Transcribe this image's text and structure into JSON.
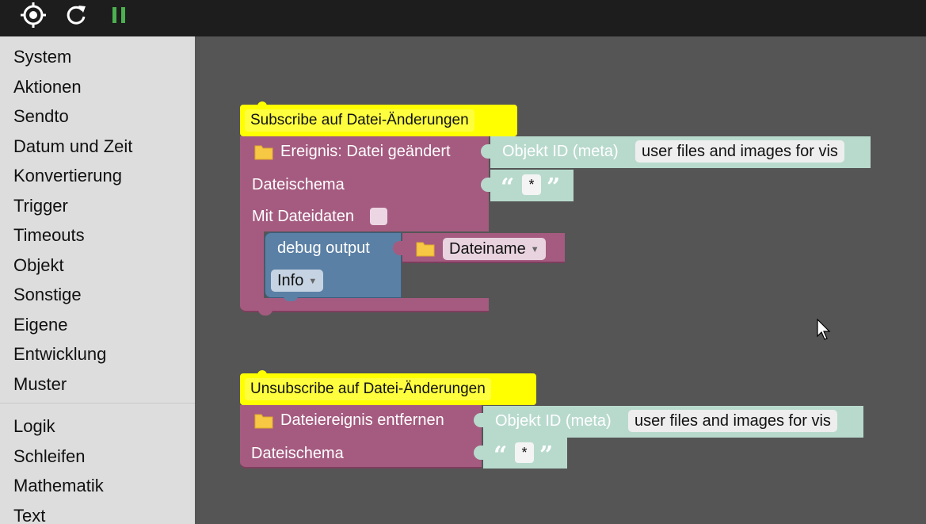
{
  "toolbar": {
    "buttons": [
      {
        "icon": "target-icon"
      },
      {
        "icon": "refresh-icon"
      },
      {
        "icon": "pause-icon"
      }
    ],
    "pause_color": "#4caf50"
  },
  "sidebar": {
    "group1": [
      "System",
      "Aktionen",
      "Sendto",
      "Datum und Zeit",
      "Konvertierung",
      "Trigger",
      "Timeouts",
      "Objekt",
      "Sonstige",
      "Eigene",
      "Entwicklung",
      "Muster"
    ],
    "group2": [
      "Logik",
      "Schleifen",
      "Mathematik",
      "Text"
    ]
  },
  "workspace": {
    "block1": {
      "comment": "Subscribe auf Datei-Änderungen",
      "event_label": "Ereignis: Datei geändert",
      "objekt_label": "Objekt ID (meta)",
      "objekt_value": "user files and images for vis",
      "schema_label": "Dateischema",
      "quote_open": "“",
      "schema_value": "*",
      "quote_close": "”",
      "mit_label": "Mit Dateidaten",
      "debug_label": "debug output",
      "var_value": "Dateiname",
      "level_value": "Info"
    },
    "block2": {
      "comment": "Unsubscribe auf Datei-Änderungen",
      "event_label": "Dateiereignis entfernen",
      "objekt_label": "Objekt ID (meta)",
      "objekt_value": "user files and images for vis",
      "schema_label": "Dateischema",
      "quote_open": "“",
      "schema_value": "*",
      "quote_close": "”"
    },
    "colors": {
      "event_block": "#a55b80",
      "text_block": "#b8dacd",
      "debug_block": "#5b80a5",
      "comment": "#ffff00",
      "folder": "#f7c843"
    }
  }
}
